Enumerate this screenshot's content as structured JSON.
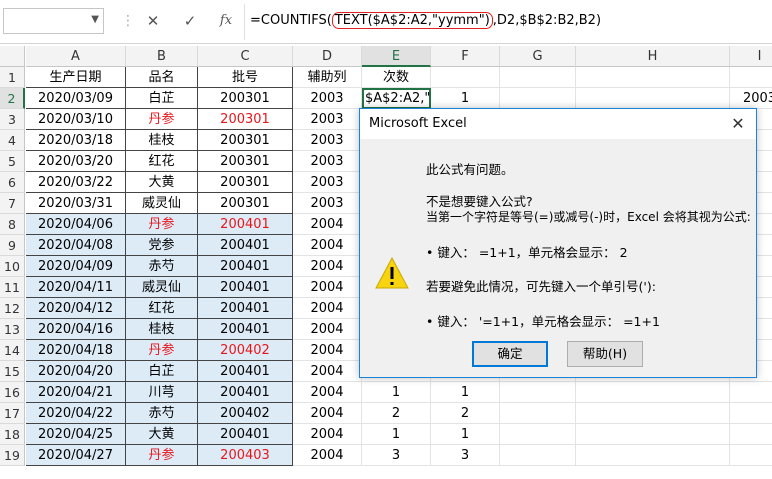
{
  "formula_bar": {
    "namebox_value": "",
    "cancel_icon": "✕",
    "enter_icon": "✓",
    "fx_icon": "fx",
    "formula_pre": "=COUNTIFS(",
    "formula_highlight": "TEXT($A$2:A2,\"yymm\")",
    "formula_post": ",D2,$B$2:B2,B2)"
  },
  "columns": [
    "A",
    "B",
    "C",
    "D",
    "E",
    "F",
    "G",
    "H",
    "I"
  ],
  "selected_column": "E",
  "header_row": [
    "生产日期",
    "品名",
    "批号",
    "辅助列",
    "次数"
  ],
  "rows": [
    {
      "n": "2",
      "a": "2020/03/09",
      "b": "白芷",
      "c": "200301",
      "d": "2003",
      "e": "$A$2:A2,\"y",
      "f": "1",
      "i": "2003",
      "red": false,
      "blue": false
    },
    {
      "n": "3",
      "a": "2020/03/10",
      "b": "丹参",
      "c": "200301",
      "d": "2003",
      "e": "",
      "f": "",
      "i": "",
      "red": true,
      "blue": false
    },
    {
      "n": "4",
      "a": "2020/03/18",
      "b": "桂枝",
      "c": "200301",
      "d": "2003",
      "e": "",
      "f": "",
      "i": "",
      "red": false,
      "blue": false
    },
    {
      "n": "5",
      "a": "2020/03/20",
      "b": "红花",
      "c": "200301",
      "d": "2003",
      "e": "",
      "f": "",
      "i": "",
      "red": false,
      "blue": false
    },
    {
      "n": "6",
      "a": "2020/03/22",
      "b": "大黄",
      "c": "200301",
      "d": "2003",
      "e": "",
      "f": "",
      "i": "",
      "red": false,
      "blue": false
    },
    {
      "n": "7",
      "a": "2020/03/31",
      "b": "威灵仙",
      "c": "200301",
      "d": "2003",
      "e": "",
      "f": "",
      "i": "",
      "red": false,
      "blue": false
    },
    {
      "n": "8",
      "a": "2020/04/06",
      "b": "丹参",
      "c": "200401",
      "d": "2004",
      "e": "",
      "f": "",
      "i": "",
      "red": true,
      "blue": true
    },
    {
      "n": "9",
      "a": "2020/04/08",
      "b": "党参",
      "c": "200401",
      "d": "2004",
      "e": "",
      "f": "",
      "i": "",
      "red": false,
      "blue": true
    },
    {
      "n": "10",
      "a": "2020/04/09",
      "b": "赤芍",
      "c": "200401",
      "d": "2004",
      "e": "",
      "f": "",
      "i": "",
      "red": false,
      "blue": true
    },
    {
      "n": "11",
      "a": "2020/04/11",
      "b": "威灵仙",
      "c": "200401",
      "d": "2004",
      "e": "",
      "f": "",
      "i": "",
      "red": false,
      "blue": true
    },
    {
      "n": "12",
      "a": "2020/04/12",
      "b": "红花",
      "c": "200401",
      "d": "2004",
      "e": "",
      "f": "",
      "i": "",
      "red": false,
      "blue": true
    },
    {
      "n": "13",
      "a": "2020/04/16",
      "b": "桂枝",
      "c": "200401",
      "d": "2004",
      "e": "",
      "f": "",
      "i": "",
      "red": false,
      "blue": true
    },
    {
      "n": "14",
      "a": "2020/04/18",
      "b": "丹参",
      "c": "200402",
      "d": "2004",
      "e": "",
      "f": "",
      "i": "",
      "red": true,
      "blue": true
    },
    {
      "n": "15",
      "a": "2020/04/20",
      "b": "白芷",
      "c": "200401",
      "d": "2004",
      "e": "",
      "f": "",
      "i": "",
      "red": false,
      "blue": true
    },
    {
      "n": "16",
      "a": "2020/04/21",
      "b": "川芎",
      "c": "200401",
      "d": "2004",
      "e": "1",
      "f": "1",
      "i": "",
      "red": false,
      "blue": true
    },
    {
      "n": "17",
      "a": "2020/04/22",
      "b": "赤芍",
      "c": "200402",
      "d": "2004",
      "e": "2",
      "f": "2",
      "i": "",
      "red": false,
      "blue": true
    },
    {
      "n": "18",
      "a": "2020/04/25",
      "b": "大黄",
      "c": "200401",
      "d": "2004",
      "e": "1",
      "f": "1",
      "i": "",
      "red": false,
      "blue": true
    },
    {
      "n": "19",
      "a": "2020/04/27",
      "b": "丹参",
      "c": "200403",
      "d": "2004",
      "e": "3",
      "f": "3",
      "i": "",
      "red": true,
      "blue": true
    }
  ],
  "dialog": {
    "title": "Microsoft Excel",
    "close_icon": "✕",
    "warning_icon": "warning-icon",
    "line1": "此公式有问题。",
    "line2": "不是想要键入公式?",
    "line3": "当第一个字符是等号(=)或减号(-)时，Excel 会将其视为公式:",
    "line4": "• 键入：  =1+1，单元格会显示：  2",
    "line5": "若要避免此情况，可先键入一个单引号('):",
    "line6": "• 键入：  '=1+1，单元格会显示：  =1+1",
    "ok_label": "确定",
    "help_label": "帮助(H)"
  },
  "colors": {
    "red_text": "#e8161b",
    "blue_fill": "#ddebf7",
    "excel_green": "#217346",
    "dialog_border": "#1883d7",
    "warning_yellow": "#f8d30f"
  }
}
